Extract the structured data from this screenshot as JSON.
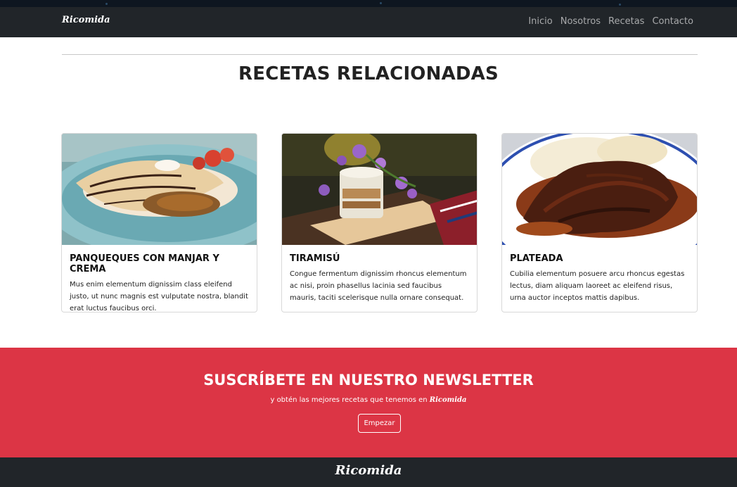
{
  "navbar": {
    "brand": "Ricomida",
    "links": [
      "Inicio",
      "Nosotros",
      "Recetas",
      "Contacto"
    ]
  },
  "section": {
    "title": "RECETAS RELACIONADAS"
  },
  "cards": [
    {
      "image": "crepes-with-chocolate-and-strawberries",
      "title": "PANQUEQUES CON MANJAR Y CREMA",
      "text": "Mus enim elementum dignissim class eleifend justo, ut nunc magnis est vulputate nostra, blandit erat luctus faucibus orci."
    },
    {
      "image": "tiramisu-glass-with-flowers",
      "title": "TIRAMISÚ",
      "text": "Congue fermentum dignissim rhoncus elementum ac nisi, proin phasellus lacinia sed faucibus mauris, taciti scelerisque nulla ornare consequat."
    },
    {
      "image": "plateada-beef-with-mashed-potatoes",
      "title": "PLATEADA",
      "text": "Cubilia elementum posuere arcu rhoncus egestas lectus, diam aliquam laoreet ac eleifend risus, urna auctor inceptos mattis dapibus."
    }
  ],
  "newsletter": {
    "title": "SUSCRÍBETE EN NUESTRO NEWSLETTER",
    "subtitle": "y obtén las mejores recetas que tenemos en",
    "subtitle_brand": "Ricomida",
    "button": "Empezar"
  },
  "footer": {
    "brand": "Ricomida"
  },
  "colors": {
    "dark": "#212529",
    "accent": "#dc3545"
  }
}
